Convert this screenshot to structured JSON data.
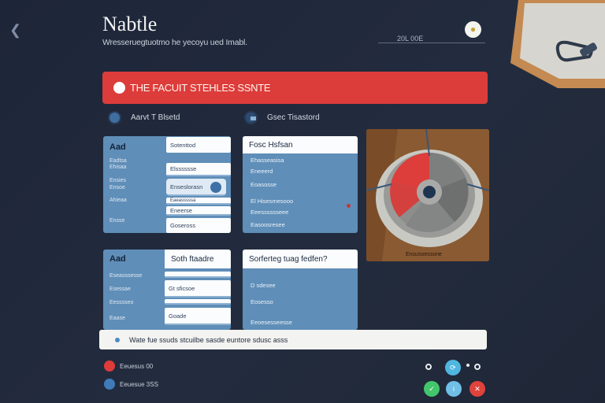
{
  "header": {
    "title": "Nabtle",
    "subtitle": "Wresseruegtuotmo he yecoyu ued Imabl.",
    "meta": "20L 00E",
    "back_icon": "chevron-left-icon",
    "settings_icon": "gear-icon"
  },
  "banner": {
    "text": "THE FACUIT STEHLES SSNTE",
    "color": "#dc3c3a"
  },
  "radios": [
    {
      "label": "Aarvt T Blsetd",
      "selected": false
    },
    {
      "label": "Gsec Tisastord",
      "selected": true
    }
  ],
  "card1": {
    "title": "Aad",
    "labels": [
      "Eadtsa",
      "Ehisaa",
      "Ensies",
      "Ensoe",
      "Ahieaa",
      "Ensse"
    ],
    "fields": [
      "Sotenttod",
      "Elsssssse",
      "Enseslorasn",
      "Eaeasssssa",
      "Eneerse",
      "Goseross"
    ]
  },
  "card2": {
    "header": "Fosc Hsfsan",
    "rows": [
      "Ehasseasisa",
      "Eneeerd",
      "Eoasosse",
      "El Hisesmesooo",
      "Eeesssssseee",
      "Easoosresee"
    ]
  },
  "gauge": {
    "caption": "Ensusoessone"
  },
  "card3": {
    "title": "Aad",
    "form_title": "Soth ftaadre",
    "labels": [
      "Eseasssesse",
      "Esessae",
      "Eesssseo",
      "Eaase"
    ],
    "fields": [
      "Gt sficsoe",
      "Goade"
    ]
  },
  "card4": {
    "header": "Sorferteg tuag fedfen?",
    "rows": [
      "D sdesee",
      "Eosesso",
      "Eeoesesseesse"
    ]
  },
  "info_bar": {
    "text": "Wate fue ssuds stcuilbe sasde euntore sdusc asss"
  },
  "legend": [
    {
      "label": "Eeuesus 00",
      "color": "#dc3c3a"
    },
    {
      "label": "Eeuesue 3SS",
      "color": "#3f7bb8"
    }
  ],
  "actions": {
    "top": [
      "o",
      "o",
      "o"
    ],
    "bottom": [
      "o",
      "o",
      "o"
    ],
    "colors": [
      "#4fb6e0",
      "#43c56c",
      "#e0423c"
    ]
  }
}
